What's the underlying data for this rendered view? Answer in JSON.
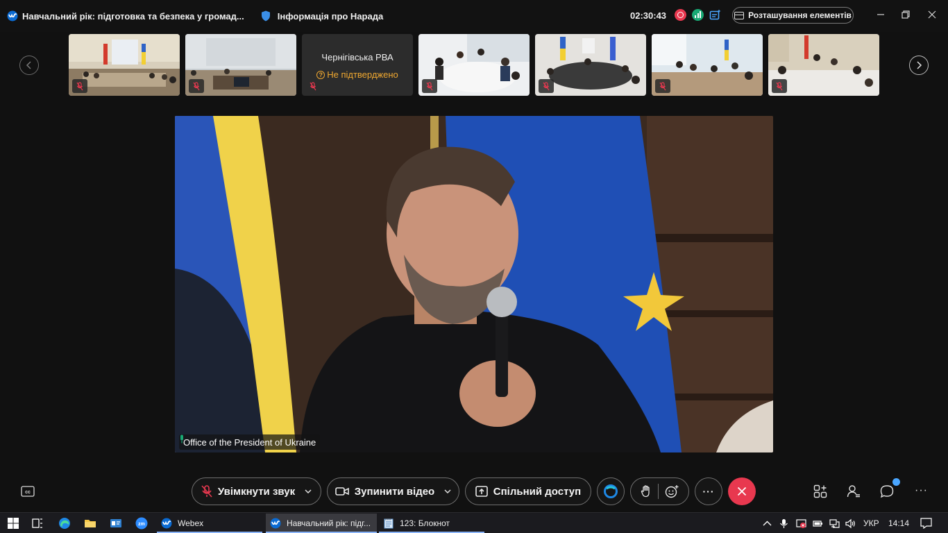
{
  "window": {
    "title": "Навчальний рік: підготовка та безпека у громад...",
    "info_label": "Інформація про Нарада",
    "timer": "02:30:43",
    "layout_button": "Розташування елементів"
  },
  "filmstrip": {
    "tiles": [
      {
        "type": "video",
        "muted": true
      },
      {
        "type": "video",
        "muted": true
      },
      {
        "type": "text",
        "name": "Чернігівська РВА",
        "status": "Не підтверджено",
        "muted": true
      },
      {
        "type": "video",
        "muted": true
      },
      {
        "type": "video",
        "muted": true
      },
      {
        "type": "video",
        "muted": true
      },
      {
        "type": "video",
        "muted": true
      }
    ]
  },
  "stage": {
    "speaker_name": "Office of the President of Ukraine"
  },
  "controls": {
    "unmute_label": "Увімкнути звук",
    "stop_video_label": "Зупинити відео",
    "share_label": "Спільний доступ",
    "more_label": "···"
  },
  "taskbar": {
    "apps": [
      {
        "label": "Webex"
      },
      {
        "label": "Навчальний рік: підг..."
      },
      {
        "label": "123: Блокнот"
      }
    ],
    "language": "УКР",
    "clock": "14:14"
  },
  "colors": {
    "accent_red": "#e8384f",
    "warning": "#f0a830",
    "background": "#111111",
    "network_green": "#19a974"
  }
}
